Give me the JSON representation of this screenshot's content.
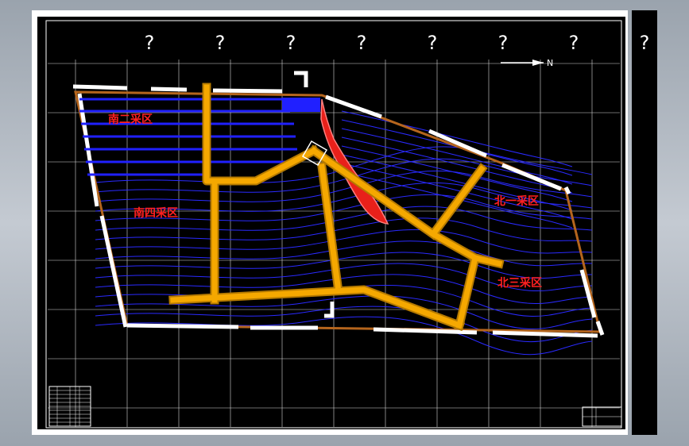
{
  "title_marks": [
    "?",
    "?",
    "?",
    "?",
    "?",
    "?",
    "?",
    "?"
  ],
  "north_arrow": {
    "label": "N"
  },
  "zones": [
    {
      "id": "south-2",
      "label": "南二采区"
    },
    {
      "id": "south-4",
      "label": "南四采区"
    },
    {
      "id": "north-1",
      "label": "北一采区"
    },
    {
      "id": "north-3",
      "label": "北三采区"
    }
  ],
  "colors": {
    "background": "#000000",
    "grid": "#ffffff",
    "boundary_brown": "#b5651d",
    "boundary_white": "#ffffff",
    "roadway_yellow": "#f5a800",
    "contour_blue": "#2020ff",
    "zone_text": "#ff2020",
    "hazard_red": "#e8201a"
  }
}
